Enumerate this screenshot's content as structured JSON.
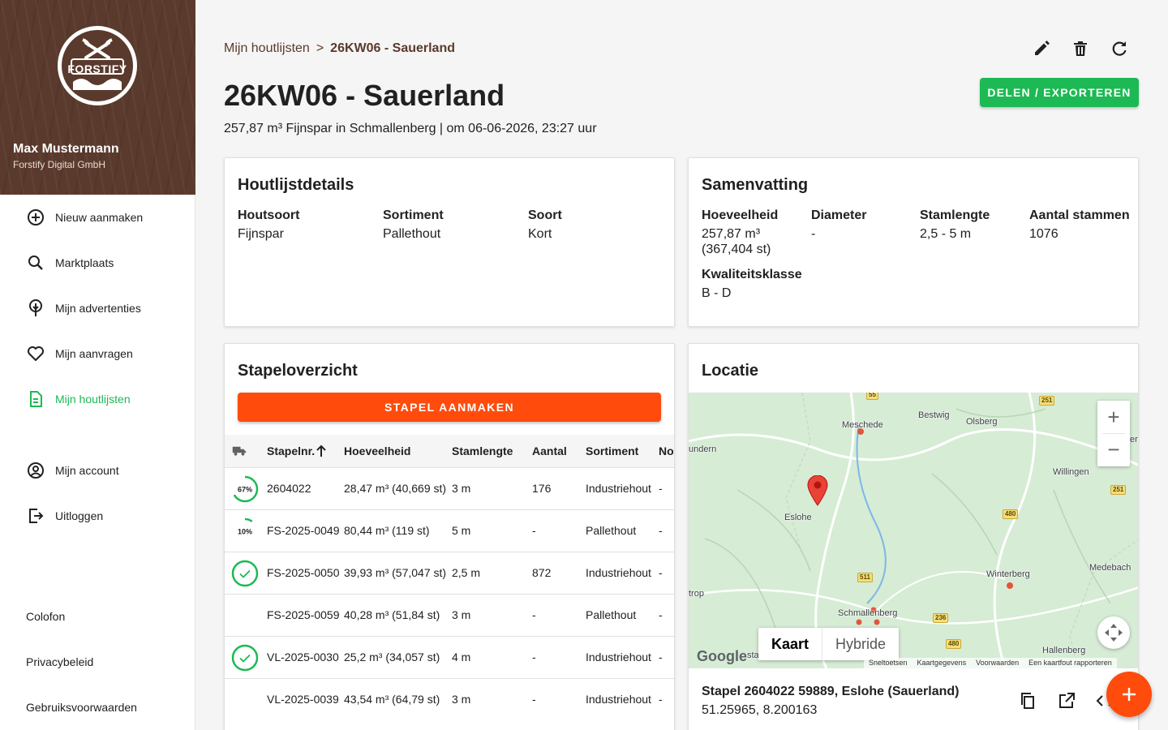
{
  "sidebar": {
    "logo_text": "FORSTIFY",
    "user_name": "Max Mustermann",
    "user_org": "Forstify Digital GmbH",
    "items": [
      {
        "label": "Nieuw aanmaken",
        "icon": "add-circle-icon"
      },
      {
        "label": "Marktplaats",
        "icon": "search-icon"
      },
      {
        "label": "Mijn advertenties",
        "icon": "tree-pin-icon"
      },
      {
        "label": "Mijn aanvragen",
        "icon": "heart-icon"
      },
      {
        "label": "Mijn houtlijsten",
        "icon": "document-icon",
        "active": true
      },
      {
        "label": "Mijn account",
        "icon": "account-circle-icon"
      },
      {
        "label": "Uitloggen",
        "icon": "logout-icon"
      }
    ],
    "footer": [
      "Colofon",
      "Privacybeleid",
      "Gebruiksvoorwaarden"
    ]
  },
  "header": {
    "breadcrumb_parent": "Mijn houtlijsten",
    "breadcrumb_sep": ">",
    "breadcrumb_current": "26KW06 - Sauerland",
    "title": "26KW06 - Sauerland",
    "subtitle": "257,87 m³ Fijnspar in Schmallenberg | om 06-06-2026, 23:27 uur",
    "share_label": "DELEN / EXPORTEREN",
    "actions": [
      "edit-icon",
      "delete-icon",
      "refresh-icon"
    ]
  },
  "details": {
    "title": "Houtlijstdetails",
    "fields": [
      {
        "label": "Houtsoort",
        "value": "Fijnspar"
      },
      {
        "label": "Sortiment",
        "value": "Pallethout"
      },
      {
        "label": "Soort",
        "value": "Kort"
      }
    ]
  },
  "summary": {
    "title": "Samenvatting",
    "quantity_label": "Hoeveelheid",
    "quantity_value": "257,87 m³",
    "quantity_pieces": "(367,404 st)",
    "diameter_label": "Diameter",
    "diameter_value": "-",
    "length_label": "Stamlengte",
    "length_value": "2,5 - 5 m",
    "count_label": "Aantal stammen",
    "count_value": "1076",
    "quality_label": "Kwaliteitsklasse",
    "quality_value": "B - D"
  },
  "stacks": {
    "title": "Stapeloverzicht",
    "create_label": "STAPEL AANMAKEN",
    "columns": [
      "Stapelnr.",
      "Hoeveelheid",
      "Stamlengte",
      "Aantal",
      "Sortiment",
      "No"
    ],
    "rows": [
      {
        "progress_label": "67%",
        "progress": 0.67,
        "nr": "2604022",
        "qty": "28,47 m³ (40,669 st)",
        "length": "3 m",
        "count": "176",
        "sort": "Industriehout",
        "no": "-"
      },
      {
        "progress_label": "10%",
        "progress": 0.1,
        "nr": "FS-2025-0049",
        "qty": "80,44 m³ (119 st)",
        "length": "5 m",
        "count": "-",
        "sort": "Pallethout",
        "no": "-"
      },
      {
        "status": "done",
        "nr": "FS-2025-0050",
        "qty": "39,93 m³ (57,047 st)",
        "length": "2,5 m",
        "count": "872",
        "sort": "Industriehout",
        "no": "-"
      },
      {
        "status": "none",
        "nr": "FS-2025-0059",
        "qty": "40,28 m³ (51,84 st)",
        "length": "3 m",
        "count": "-",
        "sort": "Pallethout",
        "no": "-"
      },
      {
        "status": "done",
        "nr": "VL-2025-0030",
        "qty": "25,2 m³ (34,057 st)",
        "length": "4 m",
        "count": "-",
        "sort": "Industriehout",
        "no": "-"
      },
      {
        "status": "none",
        "nr": "VL-2025-0039",
        "qty": "43,54 m³ (64,79 st)",
        "length": "3 m",
        "count": "-",
        "sort": "Industriehout",
        "no": "-"
      }
    ]
  },
  "location": {
    "title": "Locatie",
    "place_labels": [
      "Meschede",
      "Bestwig",
      "Olsberg",
      "Willingen",
      "Eslohe",
      "Winterberg",
      "Medebach",
      "Schmallenberg",
      "Hallenberg",
      "undern",
      "trop",
      "er",
      "sta"
    ],
    "road_labels": [
      "55",
      "251",
      "251",
      "480",
      "511",
      "236",
      "480"
    ],
    "map_type_options": [
      "Kaart",
      "Hybride"
    ],
    "map_type_selected": "Kaart",
    "google_label": "Google",
    "attribution": [
      "Sneltoetsen",
      "Kaartgegevens",
      "Voorwaarden",
      "Een kaartfout rapporteren"
    ],
    "zoom_in": "+",
    "zoom_out": "−",
    "address": "Stapel 2604022 59889, Eslohe (Sauerland)",
    "coords": "51.25965, 8.200163"
  },
  "colors": {
    "brand_brown": "#5a3a2c",
    "accent_green": "#1db954",
    "accent_orange": "#ff4c0c"
  }
}
